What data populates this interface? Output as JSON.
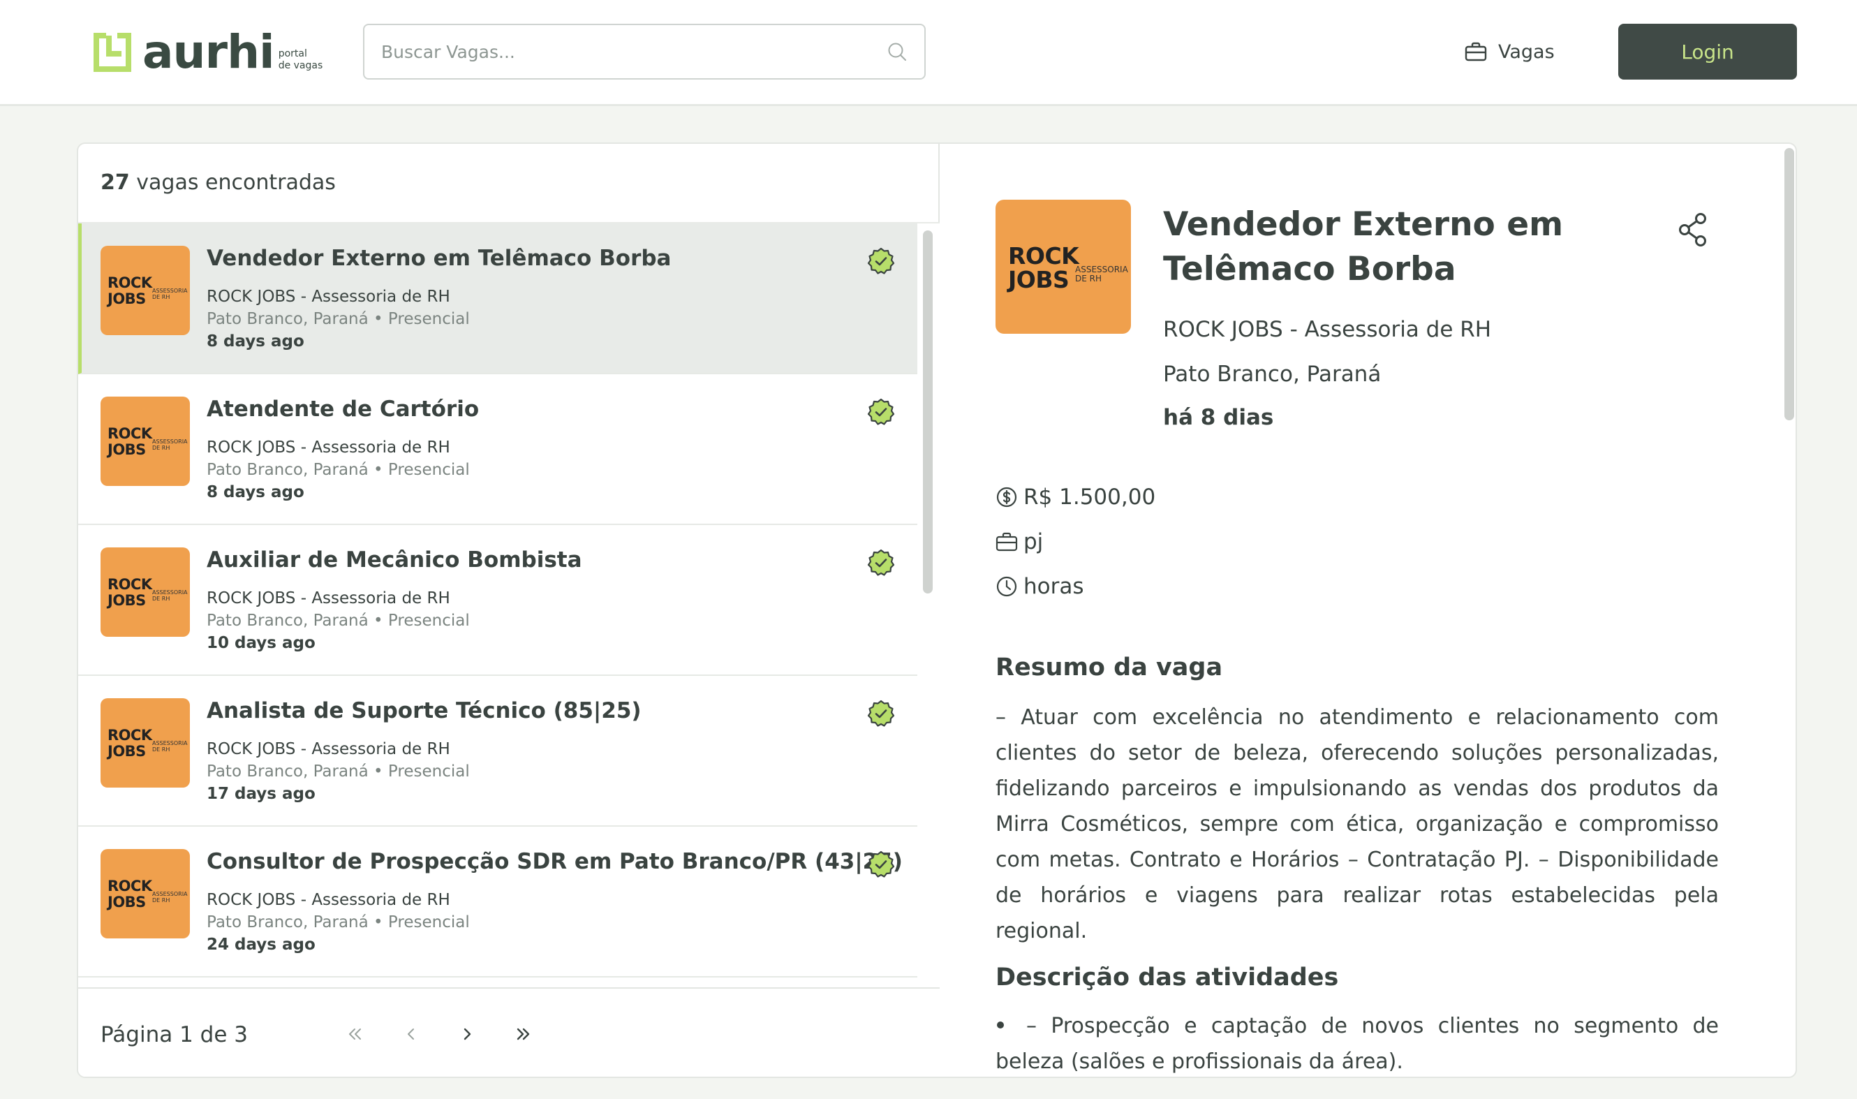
{
  "header": {
    "logo_text": "aurhi",
    "logo_sub_1": "portal",
    "logo_sub_2": "de vagas",
    "search_placeholder": "Buscar Vagas...",
    "nav_vagas": "Vagas",
    "login_label": "Login"
  },
  "list": {
    "count": "27",
    "count_suffix": " vagas encontradas",
    "logo_line1": "ROCK",
    "logo_line2": "JOBS",
    "logo_sub_1": "ASSESSORIA",
    "logo_sub_2": "DE RH",
    "items": [
      {
        "title": "Vendedor Externo em Telêmaco Borba",
        "company": "ROCK JOBS - Assessoria de RH",
        "location": "Pato Branco, Paraná • Presencial",
        "age": "8 days ago"
      },
      {
        "title": "Atendente de Cartório",
        "company": "ROCK JOBS - Assessoria de RH",
        "location": "Pato Branco, Paraná • Presencial",
        "age": "8 days ago"
      },
      {
        "title": "Auxiliar de Mecânico Bombista",
        "company": "ROCK JOBS - Assessoria de RH",
        "location": "Pato Branco, Paraná • Presencial",
        "age": "10 days ago"
      },
      {
        "title": "Analista de Suporte Técnico (85|25)",
        "company": "ROCK JOBS - Assessoria de RH",
        "location": "Pato Branco, Paraná • Presencial",
        "age": "17 days ago"
      },
      {
        "title": "Consultor de Prospecção SDR em Pato Branco/PR (43|25)",
        "company": "ROCK JOBS - Assessoria de RH",
        "location": "Pato Branco, Paraná • Presencial",
        "age": "24 days ago"
      }
    ]
  },
  "pager": {
    "label": "Página 1 de 3"
  },
  "detail": {
    "title": "Vendedor Externo em Telêmaco Borba",
    "company": "ROCK JOBS - Assessoria de RH",
    "location": "Pato Branco, Paraná",
    "age": "há 8 dias",
    "salary": "R$ 1.500,00",
    "contract": "pj",
    "schedule": "horas",
    "summary_heading": "Resumo da vaga",
    "summary_text": "– Atuar com excelência no atendimento e relacionamento com clientes do setor de beleza, oferecendo soluções personalizadas, fidelizando parceiros e impulsionando as vendas dos produtos da Mirra Cosméticos, sempre com ética, organização e compromisso com metas. Contrato e Horários – Contratação PJ. – Disponibilidade de horários e viagens para realizar rotas estabelecidas pela regional.",
    "activities_heading": "Descrição das atividades",
    "activities_first": "– Prospecção e captação de novos clientes no segmento de beleza (salões e profissionais da área)."
  },
  "colors": {
    "accent_green": "#b7de6a",
    "login_bg": "#404a46",
    "login_text": "#c9e58a",
    "logo_orange": "#f0a04d",
    "text_dark": "#3a4340"
  }
}
